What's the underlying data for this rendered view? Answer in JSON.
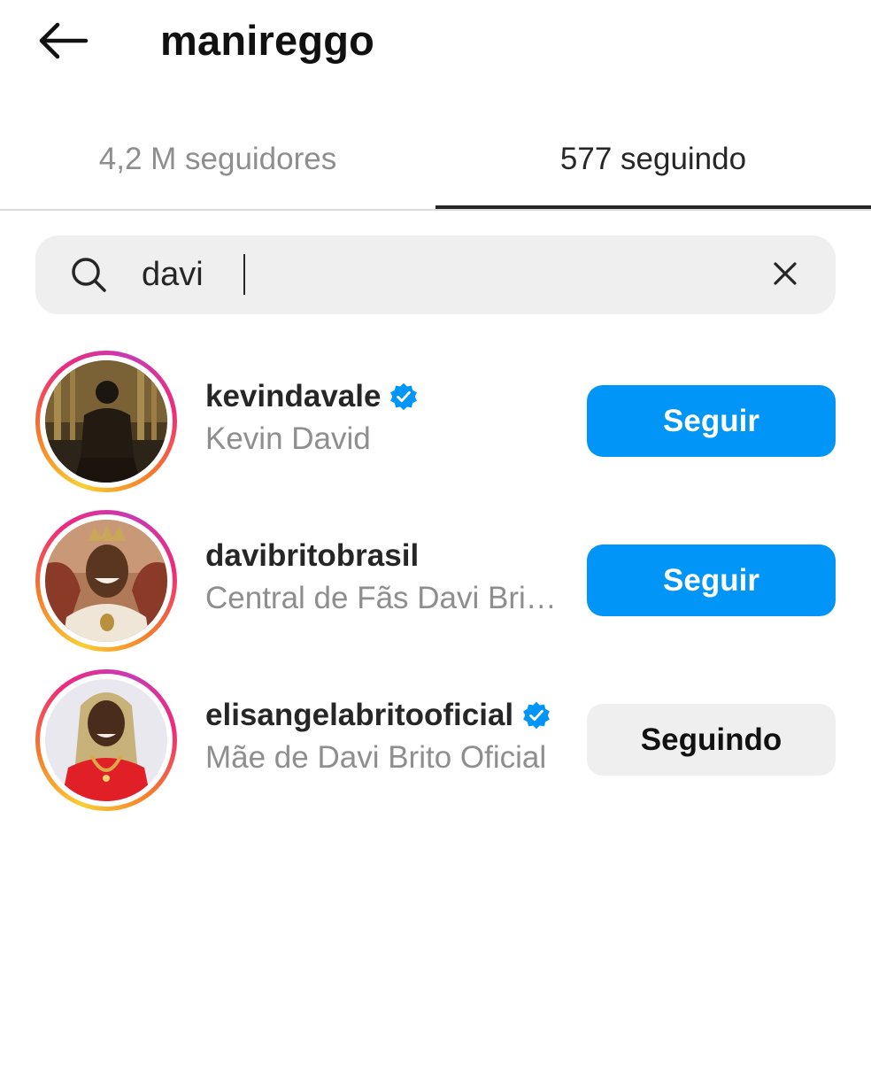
{
  "header": {
    "title": "manireggo",
    "back_icon": "arrow-left-icon"
  },
  "tabs": [
    {
      "label": "4,2 M seguidores",
      "active": false
    },
    {
      "label": "577 seguindo",
      "active": true
    }
  ],
  "search": {
    "value": "davi",
    "search_icon": "search-icon",
    "clear_icon": "close-icon"
  },
  "results": [
    {
      "username": "kevindavale",
      "full_name": "Kevin David",
      "verified": true,
      "button_label": "Seguir",
      "button_style": "primary"
    },
    {
      "username": "davibritobrasil",
      "full_name": "Central de Fãs Davi Brit…",
      "verified": false,
      "button_label": "Seguir",
      "button_style": "primary"
    },
    {
      "username": "elisangelabritooficial",
      "full_name": "Mãe de Davi Brito Oficial",
      "verified": true,
      "button_label": "Seguindo",
      "button_style": "secondary"
    }
  ],
  "colors": {
    "primary_button": "#0095f6",
    "secondary_button": "#efefef",
    "verified_badge": "#0095f6",
    "muted_text": "#8e8e8e"
  }
}
